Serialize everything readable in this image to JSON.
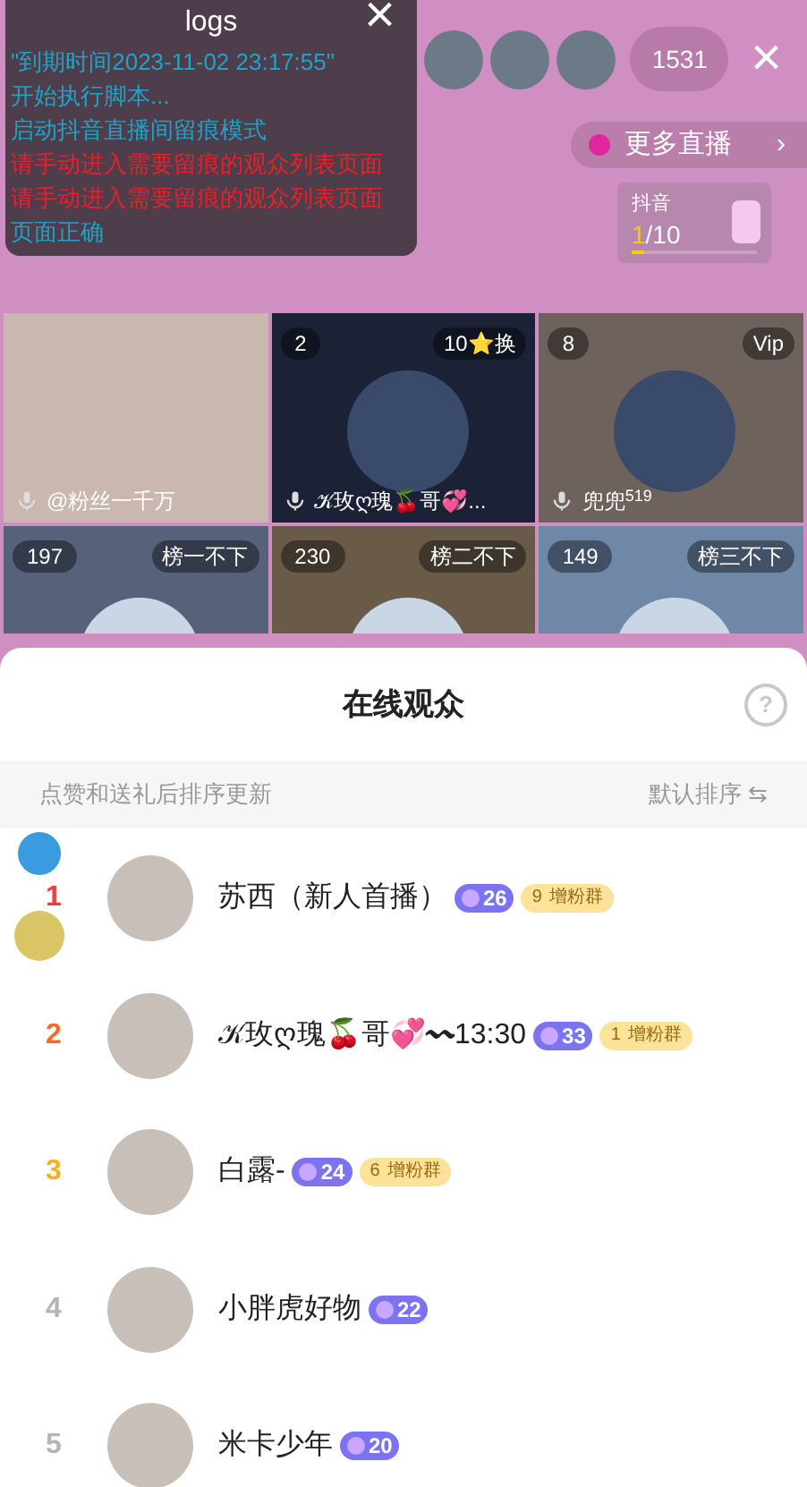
{
  "logs": {
    "title": "logs",
    "close": "×",
    "lines": [
      {
        "text": "\"到期时间2023-11-02 23:17:55\"",
        "color": "#1fa3c8"
      },
      {
        "text": "开始执行脚本...",
        "color": "#1fa3c8"
      },
      {
        "text": "启动抖音直播间留痕模式",
        "color": "#1fa3c8"
      },
      {
        "text": "请手动进入需要留痕的观众列表页面",
        "color": "#e8202a"
      },
      {
        "text": "请手动进入需要留痕的观众列表页面",
        "color": "#e8202a"
      },
      {
        "text": "页面正确",
        "color": "#1fa3c8"
      }
    ]
  },
  "top_bar": {
    "viewer_count": "1531",
    "close": "×"
  },
  "more_live": {
    "label": "更多直播",
    "chevron": "›"
  },
  "douyin_card": {
    "label": "抖音",
    "current": "1",
    "total": "/10",
    "level": 0.1
  },
  "tiles": [
    {
      "name": "@粉丝一千万"
    },
    {
      "badge": "2",
      "tag": "10⭐换",
      "name": "𝒦玫ღ瑰🍒哥💞..."
    },
    {
      "badge": "8",
      "tag": "Vip",
      "name": "兜兜$^{519}$"
    },
    {
      "badge": "197",
      "tag": "榜一不下"
    },
    {
      "badge": "230",
      "tag": "榜二不下"
    },
    {
      "badge": "149",
      "tag": "榜三不下"
    }
  ],
  "sheet": {
    "title": "在线观众",
    "help": "?",
    "hint": "点赞和送礼后排序更新",
    "sort": "默认排序 ⇆",
    "rows": [
      {
        "rank": "1",
        "color": "#ef3b3b",
        "name": "苏西（新人首播）",
        "level": "26",
        "fan_level": "9",
        "fan_label": "增粉群"
      },
      {
        "rank": "2",
        "color": "#f26b2a",
        "name": "𝒦玫ღ瑰🍒哥💞〰13:30",
        "level": "33",
        "fan_level": "1",
        "fan_label": "增粉群"
      },
      {
        "rank": "3",
        "color": "#f2b31c",
        "name": "白露-",
        "level": "24",
        "fan_level": "6",
        "fan_label": "增粉群"
      },
      {
        "rank": "4",
        "color": "#b5b5b5",
        "name": "小胖虎好物",
        "level": "22"
      },
      {
        "rank": "5",
        "color": "#b5b5b5",
        "name": "米卡少年",
        "level": "20"
      }
    ]
  }
}
